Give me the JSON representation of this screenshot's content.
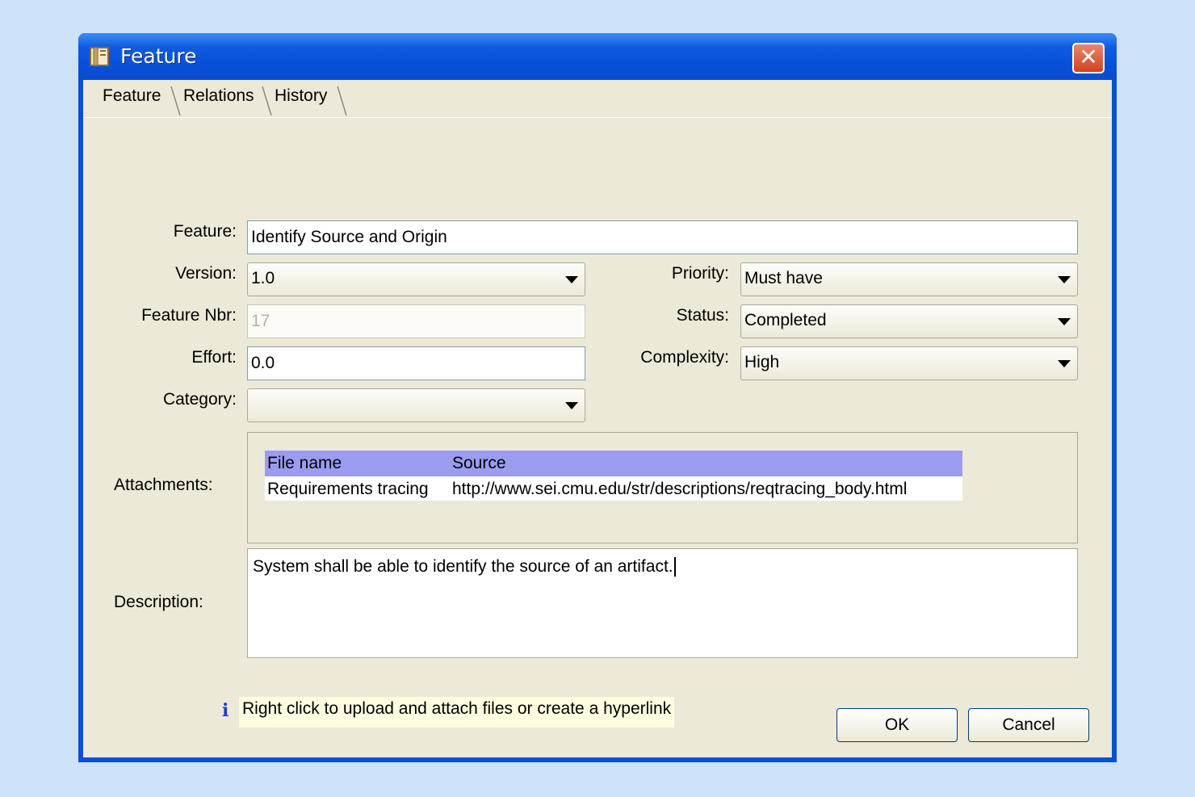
{
  "window": {
    "title": "Feature",
    "close_glyph": "✕"
  },
  "tabs": [
    {
      "label": "Feature"
    },
    {
      "label": "Relations"
    },
    {
      "label": "History"
    }
  ],
  "form": {
    "feature_label": "Feature:",
    "feature_value": "Identify Source and Origin",
    "version_label": "Version:",
    "version_value": "1.0",
    "feature_nbr_label": "Feature Nbr:",
    "feature_nbr_value": "17",
    "effort_label": "Effort:",
    "effort_value": "0.0",
    "category_label": "Category:",
    "category_value": "",
    "priority_label": "Priority:",
    "priority_value": "Must have",
    "status_label": "Status:",
    "status_value": "Completed",
    "complexity_label": "Complexity:",
    "complexity_value": "High",
    "attachments_label": "Attachments:",
    "description_label": "Description:",
    "description_value": "System shall be able to identify the source of an artifact."
  },
  "attachments": {
    "columns": [
      "File name",
      "Source"
    ],
    "rows": [
      [
        "Requirements tracing",
        "http://www.sei.cmu.edu/str/descriptions/reqtracing_body.html"
      ]
    ]
  },
  "hint": {
    "icon": "i",
    "text": "Right click to upload and attach files or create a hyperlink"
  },
  "buttons": {
    "ok": "OK",
    "cancel": "Cancel"
  },
  "colors": {
    "titlebar": "#0650d8",
    "table_header": "#9a9cf0",
    "dialog_bg": "#ece9d8",
    "desktop_bg": "#cde3fa"
  }
}
